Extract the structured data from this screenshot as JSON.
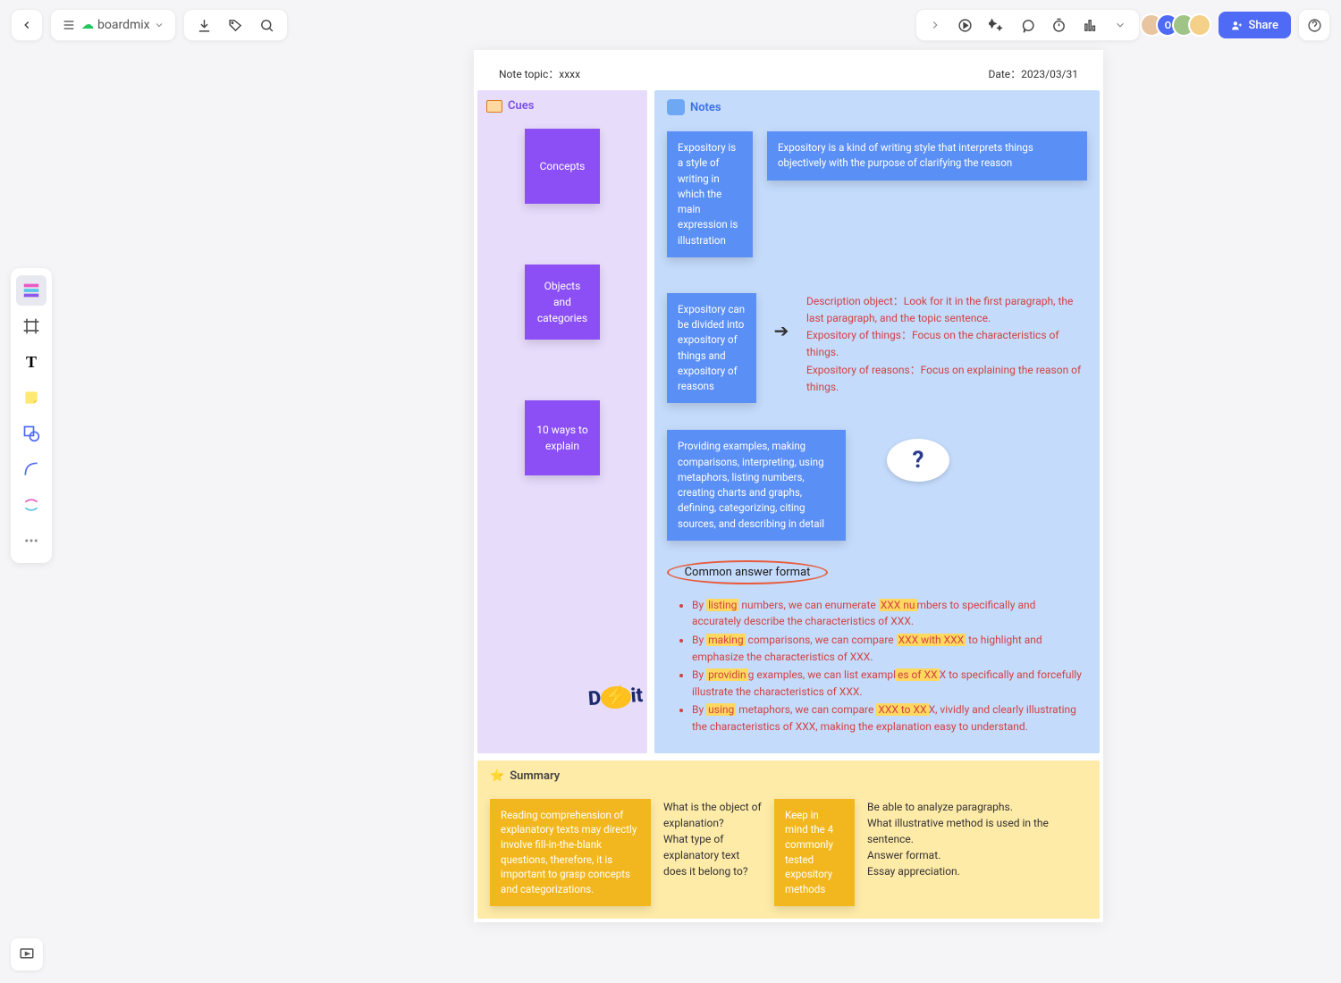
{
  "app": {
    "brand": "boardmix",
    "share_label": "Share"
  },
  "note": {
    "topic_label": "Note topic：",
    "topic_value": "xxxx",
    "date_label": "Date：",
    "date_value": "2023/03/31"
  },
  "sections": {
    "cues": "Cues",
    "notes": "Notes",
    "summary": "Summary"
  },
  "cues": {
    "items": [
      "Concepts",
      "Objects and categories",
      "10 ways to explain"
    ]
  },
  "notes": {
    "row1": {
      "a": "Expository is a style of writing in which the main expression is illustration",
      "b": "Expository is a kind of writing style that interprets things objectively with the purpose of clarifying the reason"
    },
    "row2": {
      "a": "Expository can be divided into expository of things and expository of reasons",
      "red": "Description object：Look for it in the first paragraph, the last paragraph, and the topic sentence.\nExpository of things：Focus on the characteristics of things.\nExpository of reasons：Focus on explaining the reason of things."
    },
    "row3": {
      "a": "Providing examples, making comparisons, interpreting, using metaphors, listing numbers, creating charts and graphs, defining, categorizing, citing sources, and describing in detail"
    },
    "caf": "Common answer format",
    "bullets": [
      {
        "pre": "By ",
        "hl": "listing",
        "mid": " numbers, we can enumerate ",
        "hl2": "XXX nu",
        "post": "mbers to specifically and accurately describe the characteristics of XXX."
      },
      {
        "pre": "By ",
        "hl": "making",
        "mid": " comparisons, we can compare ",
        "hl2": "XXX with XXX",
        "post": " to highlight and emphasize the characteristics of XXX."
      },
      {
        "pre": "By ",
        "hl": "providin",
        "mid": "g examples, we can list exampl",
        "hl2": "es of XX",
        "post": "X to specifically and forcefully illustrate the characteristics of XXX."
      },
      {
        "pre": "By ",
        "hl": "using",
        "mid": " metaphors, we can compare ",
        "hl2": "XXX to XX",
        "post": "X, vividly and clearly illustrating the characteristics of XXX, making the explanation easy to understand."
      }
    ],
    "doit": "D⚡it"
  },
  "summary": {
    "s1": "Reading comprehension of explanatory texts may directly involve fill-in-the-blank questions, therefore, it is important to grasp concepts and categorizations.",
    "s2": "What is the object of explanation?\nWhat type of explanatory text does it belong to?",
    "s3": "Keep in mind the 4 commonly tested expository methods",
    "s4": "Be able to analyze paragraphs.\nWhat illustrative method is used in the sentence.\nAnswer format.\nEssay appreciation."
  }
}
